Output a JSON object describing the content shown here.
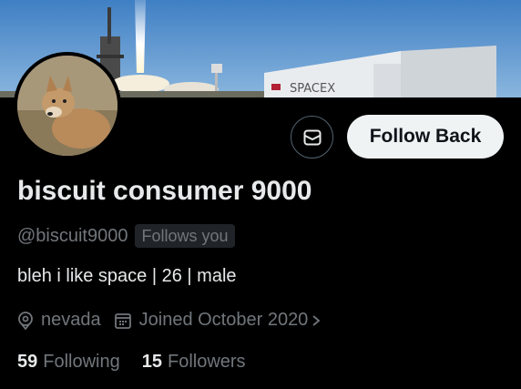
{
  "banner": {
    "building_text": "SPACEX"
  },
  "profile": {
    "display_name": "biscuit consumer 9000",
    "handle": "@biscuit9000",
    "follows_you": "Follows you",
    "bio": "bleh i like space | 26 | male",
    "location": "nevada",
    "joined": "Joined October 2020",
    "following_count": "59",
    "following_label": "Following",
    "followers_count": "15",
    "followers_label": "Followers"
  },
  "actions": {
    "follow_back_label": "Follow Back"
  },
  "icons": {
    "message": "envelope-icon",
    "location": "location-pin-icon",
    "joined": "calendar-icon",
    "expand": "chevron-right-icon"
  },
  "colors": {
    "background": "#000000",
    "primary_text": "#e7e9ea",
    "secondary_text": "#71767b",
    "follow_button_bg": "#eff3f4",
    "badge_bg": "#202327"
  }
}
